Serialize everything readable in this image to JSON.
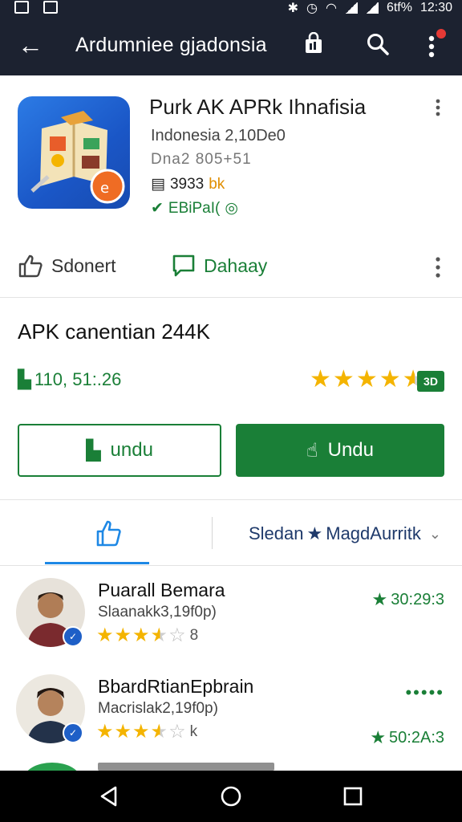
{
  "status_bar": {
    "battery": "6tf%",
    "time": "12:30"
  },
  "app_bar": {
    "title": "Ardumniee gjadonsia",
    "icons": [
      "back-arrow-icon",
      "shopping-bag-icon",
      "search-icon",
      "more-vert-icon"
    ]
  },
  "app_card": {
    "name": "Purk AK APRk Ihnafisia",
    "subtitle": "Indonesia 2,10De0",
    "version": "Dna2 805+51",
    "size_value": "3933",
    "size_unit": "bk",
    "verified": "EBiPaI(",
    "like_label": "Sdonert",
    "discuss_label": "Dahaay"
  },
  "download": {
    "title": "APK canentian 244K",
    "count": "110, 51:.26",
    "rating": 4.5,
    "badge": "3D",
    "button_outline": "undu",
    "button_solid": "Undu"
  },
  "reviews_tabs": {
    "sort_label": "Sledan",
    "sort_value": "MagdAurritk"
  },
  "reviews": [
    {
      "name": "Puarall Bemara",
      "meta": "Slaanakk3,19f0p)",
      "stars": 3.5,
      "star_count": "8",
      "score": "30:29:3"
    },
    {
      "name": "BbardRtianEpbrain",
      "meta": "Macrislak2,19f0p)",
      "stars": 3.5,
      "star_count": "k",
      "score": "50:2A:3"
    }
  ],
  "colors": {
    "bar": "#1c2230",
    "green": "#1a7f37",
    "star": "#f4b400",
    "blue": "#1e88e5"
  }
}
